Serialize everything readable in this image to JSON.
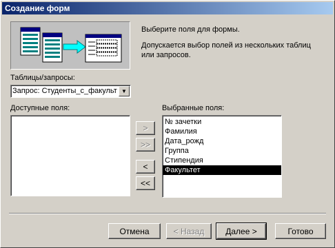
{
  "window": {
    "title": "Создание форм"
  },
  "intro": {
    "line1": "Выберите поля для формы.",
    "line2": "Допускается выбор полей из нескольких таблиц или запросов."
  },
  "tables": {
    "label": "Таблицы/запросы:",
    "selected": "Запрос: Студенты_с_факультетом"
  },
  "available": {
    "label": "Доступные поля:",
    "items": []
  },
  "selected_fields": {
    "label": "Выбранные поля:",
    "items": [
      "№ зачетки",
      "Фамилия",
      "Дата_рожд",
      "Группа",
      "Стипендия",
      "Факультет"
    ],
    "highlighted": "Факультет"
  },
  "move_buttons": {
    "add_one": ">",
    "add_all": ">>",
    "remove_one": "<",
    "remove_all": "<<"
  },
  "buttons": {
    "cancel": "Отмена",
    "back": "< Назад",
    "next": "Далее >",
    "finish": "Готово"
  }
}
